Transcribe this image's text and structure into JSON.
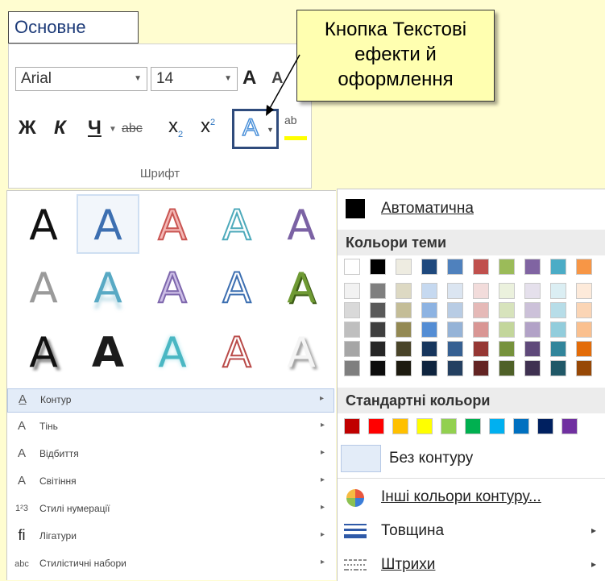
{
  "section_label": "Основне",
  "callout": {
    "line1": "Кнопка Текстові",
    "line2": "ефекти й",
    "line3": "оформлення"
  },
  "ribbon": {
    "font_name": "Arial",
    "font_size": "14",
    "bold": "Ж",
    "italic": "К",
    "underline": "Ч",
    "strike": "abc",
    "subscript": "x",
    "subscript_mark": "2",
    "superscript": "x",
    "superscript_mark": "2",
    "text_effects": "A",
    "grow": "A",
    "shrink": "A",
    "highlight": "ab",
    "group_caption": "Шрифт"
  },
  "gallery": [
    {
      "glyph": "A",
      "style": "black-solid"
    },
    {
      "glyph": "A",
      "style": "blue-solid-selected"
    },
    {
      "glyph": "A",
      "style": "red-outline"
    },
    {
      "glyph": "A",
      "style": "teal-outline"
    },
    {
      "glyph": "A",
      "style": "purple-solid"
    },
    {
      "glyph": "A",
      "style": "gray-solid"
    },
    {
      "glyph": "A",
      "style": "teal-reflection"
    },
    {
      "glyph": "A",
      "style": "lavender-outline"
    },
    {
      "glyph": "A",
      "style": "blue-outline"
    },
    {
      "glyph": "A",
      "style": "green-bevel"
    },
    {
      "glyph": "A",
      "style": "black-shadow"
    },
    {
      "glyph": "A",
      "style": "black-bold"
    },
    {
      "glyph": "A",
      "style": "teal-glow"
    },
    {
      "glyph": "A",
      "style": "red-outline-2"
    },
    {
      "glyph": "A",
      "style": "white-shadow"
    }
  ],
  "menu": [
    {
      "label": "Контур",
      "icon": "outline-icon",
      "active": true
    },
    {
      "label": "Тінь",
      "icon": "shadow-icon",
      "active": false
    },
    {
      "label": "Відбиття",
      "icon": "reflection-icon",
      "active": false
    },
    {
      "label": "Світіння",
      "icon": "glow-icon",
      "active": false
    },
    {
      "label": "Стилі нумерації",
      "icon": "number-style-icon",
      "active": false
    },
    {
      "label": "Лігатури",
      "icon": "ligature-icon",
      "active": false
    },
    {
      "label": "Стилістичні набори",
      "icon": "stylistic-set-icon",
      "active": false
    }
  ],
  "color_panel": {
    "automatic": "Автоматична",
    "theme_header": "Кольори теми",
    "standard_header": "Стандартні кольори",
    "no_outline": "Без контуру",
    "more_colors": "Інші кольори контуру...",
    "weight": "Товщина",
    "dashes": "Штрихи",
    "theme_colors": [
      [
        "#ffffff",
        "#f2f2f2",
        "#d9d9d9",
        "#bfbfbf",
        "#a6a6a6",
        "#7f7f7f"
      ],
      [
        "#000000",
        "#7f7f7f",
        "#595959",
        "#3f3f3f",
        "#262626",
        "#0d0d0d"
      ],
      [
        "#eeece1",
        "#ddd9c3",
        "#c4bd97",
        "#938953",
        "#494429",
        "#1d1b10"
      ],
      [
        "#1f497d",
        "#c6d9f0",
        "#8db3e2",
        "#548dd4",
        "#17365d",
        "#0f243e"
      ],
      [
        "#4f81bd",
        "#dbe5f1",
        "#b8cce4",
        "#95b3d7",
        "#366092",
        "#244061"
      ],
      [
        "#c0504d",
        "#f2dcdb",
        "#e5b9b7",
        "#d99694",
        "#953734",
        "#632423"
      ],
      [
        "#9bbb59",
        "#ebf1dd",
        "#d7e3bc",
        "#c3d69b",
        "#76923c",
        "#4f6128"
      ],
      [
        "#8064a2",
        "#e5e0ec",
        "#ccc1d9",
        "#b2a2c7",
        "#5f497a",
        "#3f3151"
      ],
      [
        "#4bacc6",
        "#dbeef3",
        "#b7dde8",
        "#92cddc",
        "#31859b",
        "#205867"
      ],
      [
        "#f79646",
        "#fdeada",
        "#fbd5b5",
        "#fac08f",
        "#e36c09",
        "#974806"
      ]
    ],
    "standard_colors": [
      "#c00000",
      "#ff0000",
      "#ffc000",
      "#ffff00",
      "#92d050",
      "#00b050",
      "#00b0f0",
      "#0070c0",
      "#002060",
      "#7030a0"
    ]
  }
}
